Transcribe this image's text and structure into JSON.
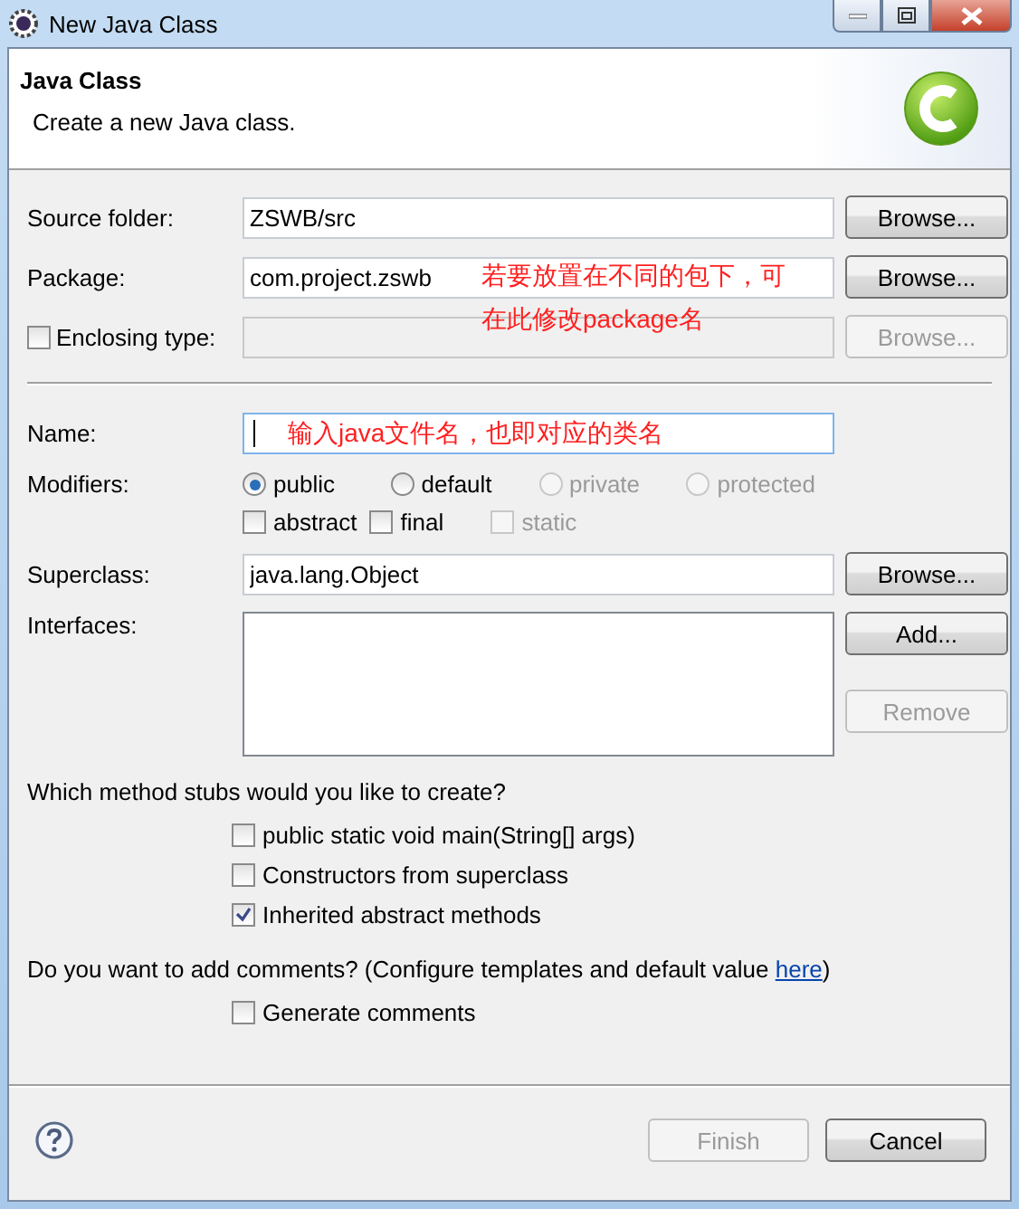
{
  "window": {
    "title": "New Java Class"
  },
  "header": {
    "title": "Java Class",
    "description": "Create a new Java class."
  },
  "source_folder": {
    "label": "Source folder:",
    "value": "ZSWB/src",
    "button": {
      "label": "Browse...",
      "disabled": false
    }
  },
  "package": {
    "label": "Package:",
    "value": "com.project.zswb",
    "button": {
      "label": "Browse...",
      "disabled": false
    },
    "annotation": [
      "若要放置在不同的包下，可",
      "在此修改package名"
    ]
  },
  "enclosing_type": {
    "label": "Enclosing type:",
    "checked": false,
    "disabled": true,
    "button": {
      "label": "Browse...",
      "disabled": true
    }
  },
  "name": {
    "label": "Name:",
    "annotation": "输入java文件名，也即对应的类名"
  },
  "modifiers": {
    "label": "Modifiers:",
    "radios": [
      {
        "label": "public",
        "selected": true,
        "disabled": false
      },
      {
        "label": "default",
        "selected": false,
        "disabled": false
      },
      {
        "label": "private",
        "selected": false,
        "disabled": true
      },
      {
        "label": "protected",
        "selected": false,
        "disabled": true
      }
    ],
    "checks": [
      {
        "label": "abstract",
        "checked": false,
        "disabled": false
      },
      {
        "label": "final",
        "checked": false,
        "disabled": false
      },
      {
        "label": "static",
        "checked": false,
        "disabled": true
      }
    ]
  },
  "superclass": {
    "label": "Superclass:",
    "value": "java.lang.Object",
    "button": {
      "label": "Browse...",
      "disabled": false
    }
  },
  "interfaces": {
    "label": "Interfaces:",
    "buttons": [
      {
        "label": "Add...",
        "disabled": false
      },
      {
        "label": "Remove",
        "disabled": true
      }
    ]
  },
  "stubs": {
    "question": "Which method stubs would you like to create?",
    "options": [
      {
        "label": "public static void main(String[] args)",
        "checked": false
      },
      {
        "label": "Constructors from superclass",
        "checked": false
      },
      {
        "label": "Inherited abstract methods",
        "checked": true
      }
    ]
  },
  "comments": {
    "question": "Do you want to add comments? (Configure templates and default value ",
    "link": "here",
    "tail": ")",
    "options": [
      {
        "label": "Generate comments",
        "checked": false
      }
    ]
  },
  "footer": {
    "buttons": [
      {
        "label": "Finish",
        "disabled": true
      },
      {
        "label": "Cancel",
        "disabled": false
      }
    ]
  }
}
